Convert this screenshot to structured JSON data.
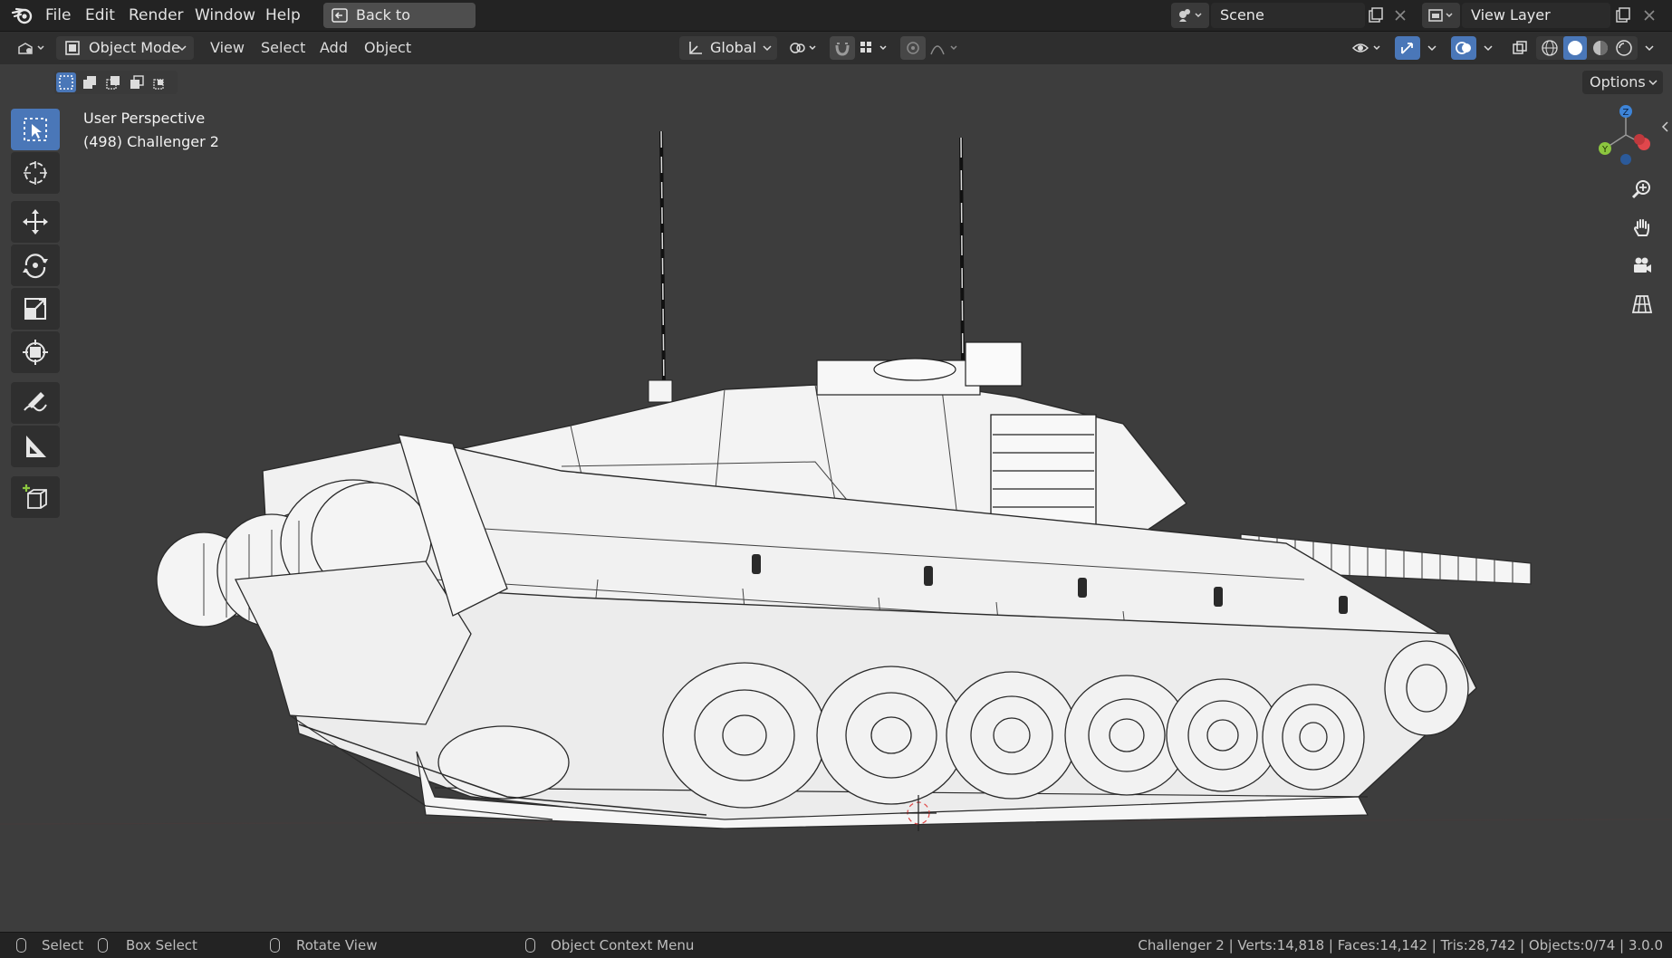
{
  "menu": {
    "items": [
      "File",
      "Edit",
      "Render",
      "Window",
      "Help"
    ],
    "back_label": "Back to Previous"
  },
  "scene": {
    "label": "Scene"
  },
  "view_layer": {
    "label": "View Layer"
  },
  "header": {
    "mode_label": "Object Mode",
    "menus": [
      "View",
      "Select",
      "Add",
      "Object"
    ],
    "orientation_label": "Global",
    "options_label": "Options"
  },
  "viewport": {
    "perspective_label": "User Perspective",
    "object_label": "(498) Challenger 2"
  },
  "tools": [
    "select-box-tool",
    "cursor-tool",
    "move-tool",
    "rotate-tool",
    "scale-tool",
    "transform-tool",
    "annotate-tool",
    "measure-tool",
    "add-cube-tool"
  ],
  "navigation": [
    "gizmo",
    "zoom-icon",
    "pan-hand-icon",
    "camera-icon",
    "grid-icon"
  ],
  "statusbar": {
    "select": "Select",
    "box_select": "Box Select",
    "rotate_view": "Rotate View",
    "context_menu": "Object Context Menu",
    "stats": "Challenger 2 | Verts:14,818 | Faces:14,142 | Tris:28,742 | Objects:0/74 | 3.0.0"
  },
  "colors": {
    "accent": "#4a77b8",
    "axis_x": "#e0474c",
    "axis_y": "#8cc63f",
    "axis_z": "#3d84d8"
  }
}
